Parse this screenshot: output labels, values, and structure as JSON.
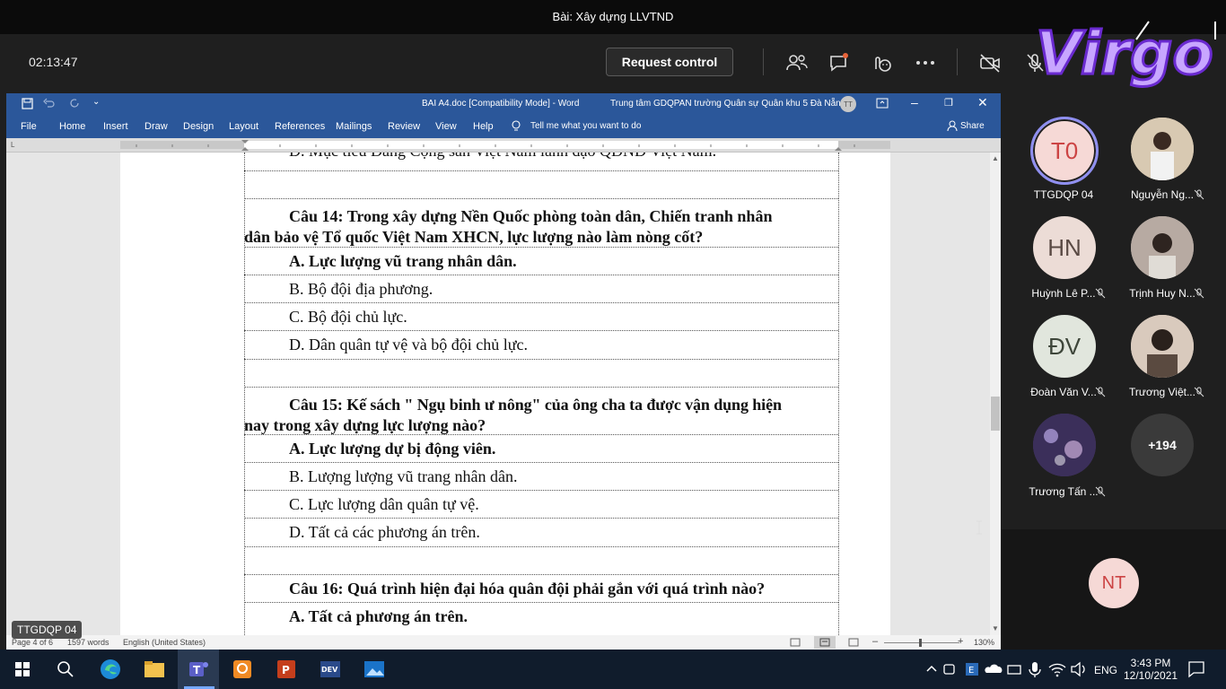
{
  "meeting": {
    "title": "Bài: Xây dựng LLVTND",
    "timer": "02:13:47",
    "request_control_label": "Request control",
    "presenter_name": "TTGDQP 04"
  },
  "word": {
    "title_doc": "BAI A4.doc [Compatibility Mode]  -  Word",
    "title_user": "Trung tâm GDQPAN trường Quân sự Quân khu 5 Đà Nẵng",
    "title_user_initials": "TT",
    "tabs": [
      "File",
      "Home",
      "Insert",
      "Draw",
      "Design",
      "Layout",
      "References",
      "Mailings",
      "Review",
      "View",
      "Help"
    ],
    "tell_me": "Tell me what you want to do",
    "share": "Share",
    "status": {
      "page": "Page 4 of 6",
      "words": "1597 words",
      "language": "English (United States)",
      "zoom": "130%"
    },
    "document": {
      "top_partial": "D. Mục tiêu Đảng Cộng sản Việt Nam lãnh đạo QĐND Việt Nam.",
      "q14": {
        "line1": "Câu 14: Trong xây dựng Nền Quốc phòng toàn dân, Chiến tranh nhân",
        "line2": "dân bảo vệ Tổ quốc Việt Nam XHCN, lực lượng nào làm nòng cốt?",
        "a": "A. Lực lượng vũ trang nhân dân.",
        "b": "B. Bộ đội địa phương.",
        "c": "C. Bộ đội chủ lực.",
        "d": "D. Dân quân tự vệ và bộ đội chủ lực."
      },
      "q15": {
        "line1": "Câu 15: Kế sách \" Ngụ binh ư nông\" của ông cha ta được vận dụng hiện",
        "line2": "nay trong xây dựng lực lượng nào?",
        "a": "A. Lực lượng dự bị động viên.",
        "b": "B. Lượng lượng vũ trang nhân dân.",
        "c": "C. Lực lượng dân quân tự vệ.",
        "d": "D. Tất cả các phương án trên."
      },
      "q16": {
        "line1": "Câu 16: Quá trình hiện đại hóa quân đội phải gắn với quá trình nào?",
        "a": "A. Tất cả phương án trên."
      }
    }
  },
  "participants": [
    {
      "initials": "T0",
      "name": "TTGDQP 04",
      "muted": false,
      "color": "#f6d9d6"
    },
    {
      "initials": "",
      "name": "Nguyễn Ng...",
      "muted": true,
      "color": "#c9b79c"
    },
    {
      "initials": "HN",
      "name": "Huỳnh Lê P...",
      "muted": true,
      "color": "#ecdcd6"
    },
    {
      "initials": "",
      "name": "Trịnh Huy N...",
      "muted": true,
      "color": "#a8a09a"
    },
    {
      "initials": "ĐV",
      "name": "Đoàn Văn V...",
      "muted": true,
      "color": "#e1e6dd"
    },
    {
      "initials": "",
      "name": "Trương Việt...",
      "muted": true,
      "color": "#cfc1b7"
    },
    {
      "initials": "",
      "name": "Trương Tấn ...",
      "muted": true,
      "color": "#4a3a6a"
    },
    {
      "initials": "+194",
      "name": "",
      "muted": false,
      "color": "#3a3a3a"
    }
  ],
  "panel_bottom_avatar": {
    "initials": "NT",
    "color": "#f6d9d6"
  },
  "taskbar": {
    "language": "ENG",
    "time": "3:43 PM",
    "date": "12/10/2021"
  },
  "logo_text": "Virgo"
}
